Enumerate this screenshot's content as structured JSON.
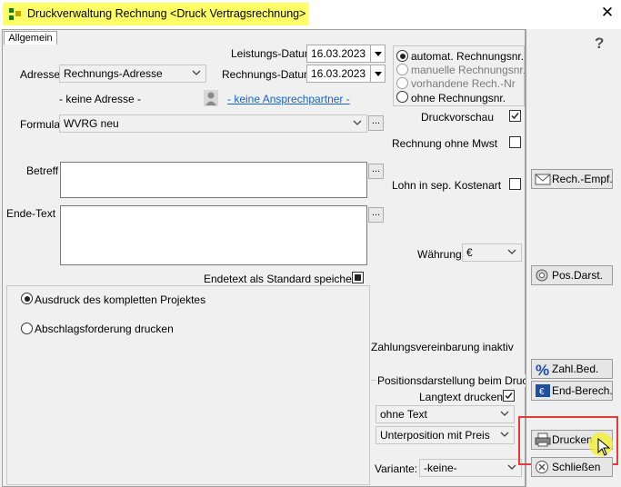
{
  "window": {
    "title": "Druckverwaltung Rechnung <Druck Vertragsrechnung>",
    "close_glyph": "✕",
    "highlight_color": "#ffff66"
  },
  "tabs": {
    "allgemein": "Allgemein"
  },
  "dates": {
    "leistungs_label": "Leistungs-Datum",
    "leistungs_value": "16.03.2023",
    "rechnungs_label": "Rechnungs-Datum",
    "rechnungs_value": "16.03.2023"
  },
  "adresse": {
    "label": "Adresse",
    "value": "Rechnungs-Adresse",
    "none_text": "- keine Adresse -",
    "contact_link": "- keine Ansprechpartner -"
  },
  "numbering": {
    "options": [
      {
        "label": "automat. Rechnungsnr.",
        "selected": true,
        "enabled": true
      },
      {
        "label": "manuelle Rechnungsnr.",
        "selected": false,
        "enabled": false
      },
      {
        "label": "vorhandene Rech.-Nr",
        "selected": false,
        "enabled": false
      },
      {
        "label": "ohne Rechnungsnr.",
        "selected": false,
        "enabled": true
      }
    ]
  },
  "formular": {
    "label": "Formular",
    "value": "WVRG neu",
    "dots": "..."
  },
  "betreff": {
    "label": "Betreff",
    "dots": "..."
  },
  "endetext": {
    "label": "Ende-Text",
    "dots": "...",
    "save_label": "Endetext als Standard speichern"
  },
  "options": {
    "druckvorschau": "Druckvorschau",
    "ohne_mwst": "Rechnung ohne Mwst",
    "lohn_sep": "Lohn in sep. Kostenart"
  },
  "waehrung": {
    "label": "Währung",
    "value": "€"
  },
  "scope": {
    "options": [
      {
        "label": "Ausdruck des kompletten Projektes",
        "selected": true
      },
      {
        "label": "Abschlagsforderung drucken",
        "selected": false
      }
    ]
  },
  "zahlung": {
    "text": "Zahlungsvereinbarung inaktiv"
  },
  "positions": {
    "heading": "Positionsdarstellung beim Druck",
    "langtext_label": "Langtext drucken",
    "text_select": "ohne Text",
    "pos_select": "Unterposition mit Preis"
  },
  "variante": {
    "label": "Variante:",
    "value": "-keine-"
  },
  "buttons": {
    "rech_empf": "Rech.-Empf.",
    "pos_darst": "Pos.Darst.",
    "zahl_bed": "Zahl.Bed.",
    "end_berech": "End-Berech.",
    "drucken": "Drucken",
    "schliessen": "Schließen"
  },
  "help_glyph": "?",
  "colors": {
    "accent_red": "#e53b3b",
    "link_blue": "#1764c4",
    "cursor_highlight": "#f2ef3c"
  }
}
